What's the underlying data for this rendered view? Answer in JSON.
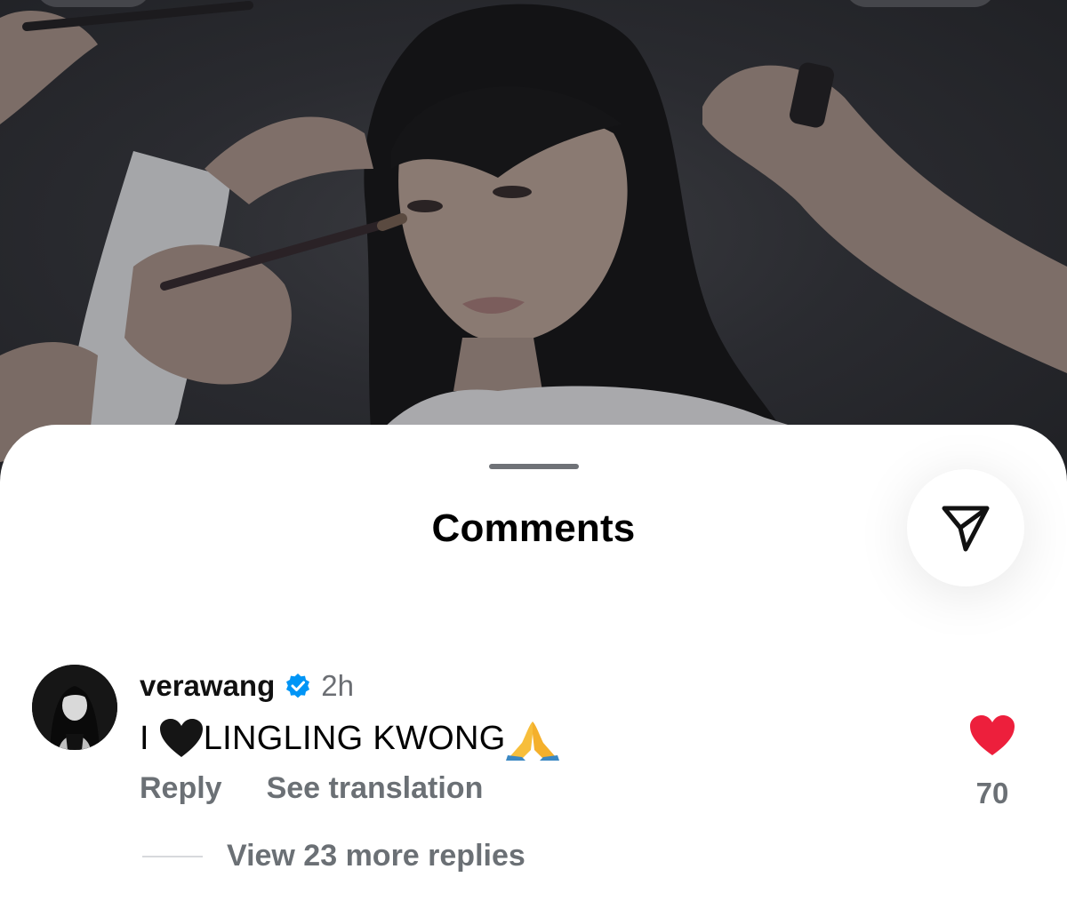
{
  "sheet": {
    "title": "Comments"
  },
  "comment": {
    "username": "verawang",
    "time": "2h",
    "text_prefix": "I ",
    "text_main": "LINGLING KWONG",
    "emojis": [
      "black-heart-icon",
      "folded-hands-icon"
    ],
    "reply_label": "Reply",
    "translate_label": "See translation",
    "like_count": "70",
    "view_replies_label": "View 23 more replies",
    "liked": true
  },
  "colors": {
    "like_red": "#ed1f3c",
    "verified_blue": "#0095f6",
    "secondary_text": "#6b7075"
  }
}
